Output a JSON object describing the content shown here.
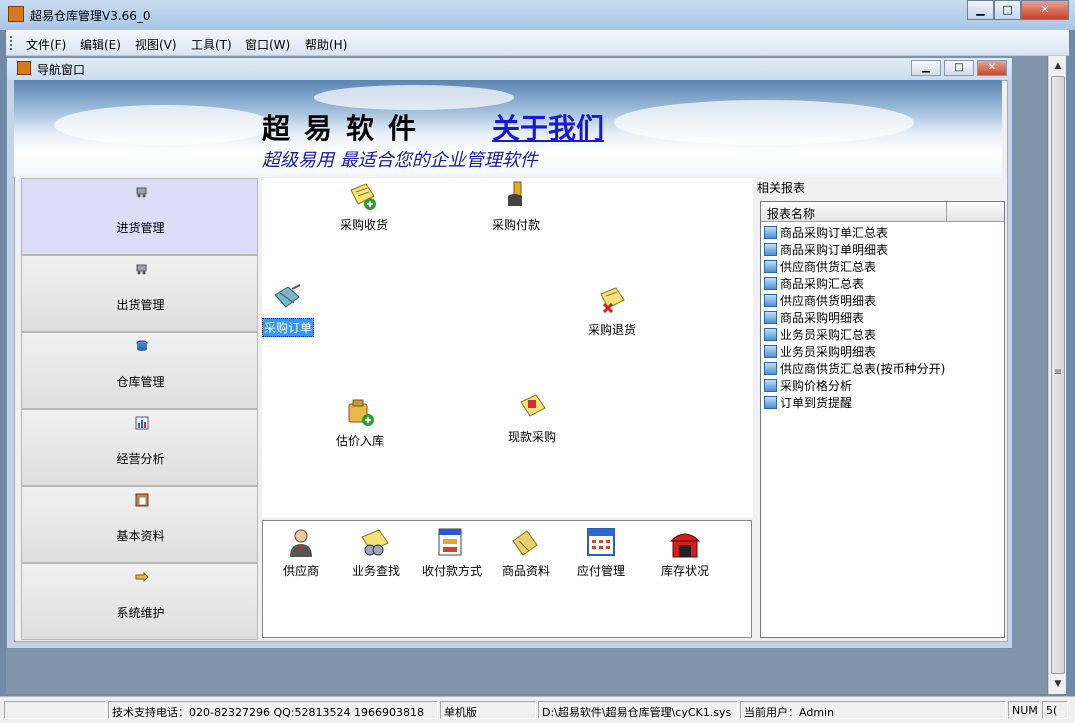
{
  "window": {
    "title": "超易仓库管理V3.66_0",
    "min": "▁",
    "max": "□",
    "close": "✕"
  },
  "menu": [
    "文件(F)",
    "编辑(E)",
    "视图(V)",
    "工具(T)",
    "窗口(W)",
    "帮助(H)"
  ],
  "child_window": {
    "title": "导航窗口",
    "min": "▁",
    "max": "□",
    "close": "✕"
  },
  "banner": {
    "title": "超易软件",
    "about": "关于我们",
    "slogan": "超级易用  最适合您的企业管理软件"
  },
  "nav": [
    "进货管理",
    "出货管理",
    "仓库管理",
    "经营分析",
    "基本资料",
    "系统维护"
  ],
  "nav_active": "进货管理",
  "workflow": {
    "receive": "采购收货",
    "pay": "采购付款",
    "order": "采购订单",
    "return": "采购退货",
    "estimate": "估价入库",
    "cash": "现款采购"
  },
  "shortcuts": [
    "供应商",
    "业务查找",
    "收付款方式",
    "商品资料",
    "应付管理",
    "库存状况"
  ],
  "reports": {
    "title": "相关报表",
    "column": "报表名称",
    "items": [
      "商品采购订单汇总表",
      "商品采购订单明细表",
      "供应商供货汇总表",
      "商品采购汇总表",
      "供应商供货明细表",
      "商品采购明细表",
      "业务员采购汇总表",
      "业务员采购明细表",
      "供应商供货汇总表(按币种分开)",
      "采购价格分析",
      "订单到货提醒"
    ]
  },
  "status": {
    "support": "技术支持电话：020-82327296 QQ:52813524 1966903818",
    "edition": "单机版",
    "path": "D:\\超易软件\\超易仓库管理\\cyCK1.sys",
    "user": "当前用户：Admin",
    "num": "NUM",
    "extra": "5("
  },
  "scroll": {
    "up": "▲",
    "down": "▼",
    "grip": "≡"
  }
}
